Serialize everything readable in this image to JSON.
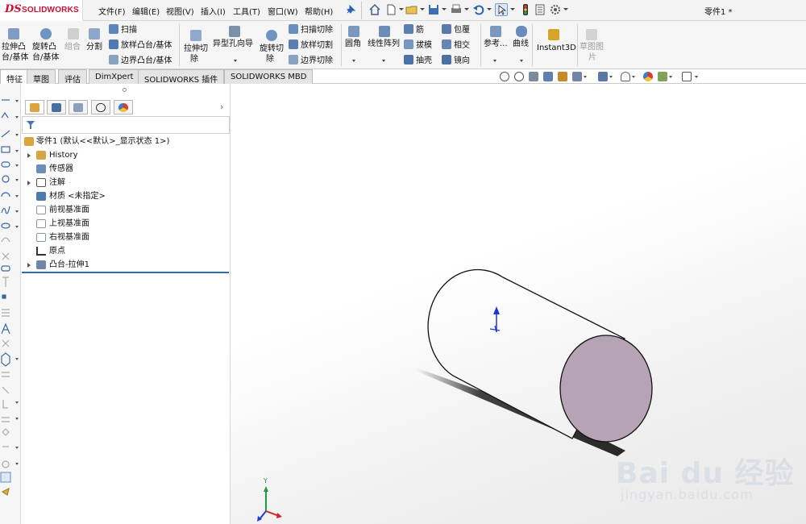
{
  "app": {
    "brand": "SOLIDWORKS",
    "doc_title": "零件1 *"
  },
  "menu": {
    "items": [
      "文件(F)",
      "编辑(E)",
      "视图(V)",
      "插入(I)",
      "工具(T)",
      "窗口(W)",
      "帮助(H)"
    ]
  },
  "ribbon": {
    "extrude_boss": [
      "拉伸凸",
      "台/基体"
    ],
    "revolve_boss": [
      "旋转凸",
      "台/基体"
    ],
    "combine": "组合",
    "split": "分割",
    "sweep": "扫描",
    "loft_boss": "放样凸台/基体",
    "boundary_boss": "边界凸台/基体",
    "extrude_cut": [
      "拉伸切",
      "除"
    ],
    "hole_wizard": "异型孔向导",
    "revolve_cut": [
      "旋转切",
      "除"
    ],
    "swept_cut": "扫描切除",
    "lofted_cut": "放样切割",
    "boundary_cut": "边界切除",
    "fillet": "圆角",
    "linear_pattern": "线性阵列",
    "rib": "筋",
    "draft": "拔模",
    "shell": "抽壳",
    "wrap": "包覆",
    "intersect": "相交",
    "mirror": "镜向",
    "reference": "参考...",
    "curves": "曲线",
    "instant3d": "Instant3D",
    "sketch_picture": [
      "草图图",
      "片"
    ]
  },
  "tabs": [
    "特征",
    "草图",
    "评估",
    "DimXpert",
    "SOLIDWORKS 插件",
    "SOLIDWORKS MBD"
  ],
  "tree": {
    "root": "零件1  (默认<<默认>_显示状态 1>)",
    "items": [
      {
        "label": "History",
        "expandable": true,
        "icon_color": "#d9a441"
      },
      {
        "label": "传感器",
        "expandable": false,
        "icon_color": "#6b8fb8"
      },
      {
        "label": "注解",
        "expandable": true,
        "icon_color": "#7c7c7c"
      },
      {
        "label": "材质 <未指定>",
        "expandable": false,
        "icon_color": "#4a7ab0"
      },
      {
        "label": "前视基准面",
        "expandable": false,
        "icon_color": "#9aa5b5"
      },
      {
        "label": "上视基准面",
        "expandable": false,
        "icon_color": "#9aa5b5"
      },
      {
        "label": "右视基准面",
        "expandable": false,
        "icon_color": "#9aa5b5"
      },
      {
        "label": "原点",
        "expandable": false,
        "icon_color": "#333333"
      },
      {
        "label": "凸台-拉伸1",
        "expandable": true,
        "icon_color": "#6f86a8"
      }
    ]
  },
  "viewport": {
    "triad_y": "Y",
    "watermark_big": "Bai du 经验",
    "watermark_small": "jingyan.baidu.com"
  },
  "colors": {
    "cylinder_face": "#b7a3b6",
    "cylinder_body": "#ffffff",
    "accent_blue": "#2a6fb5"
  }
}
